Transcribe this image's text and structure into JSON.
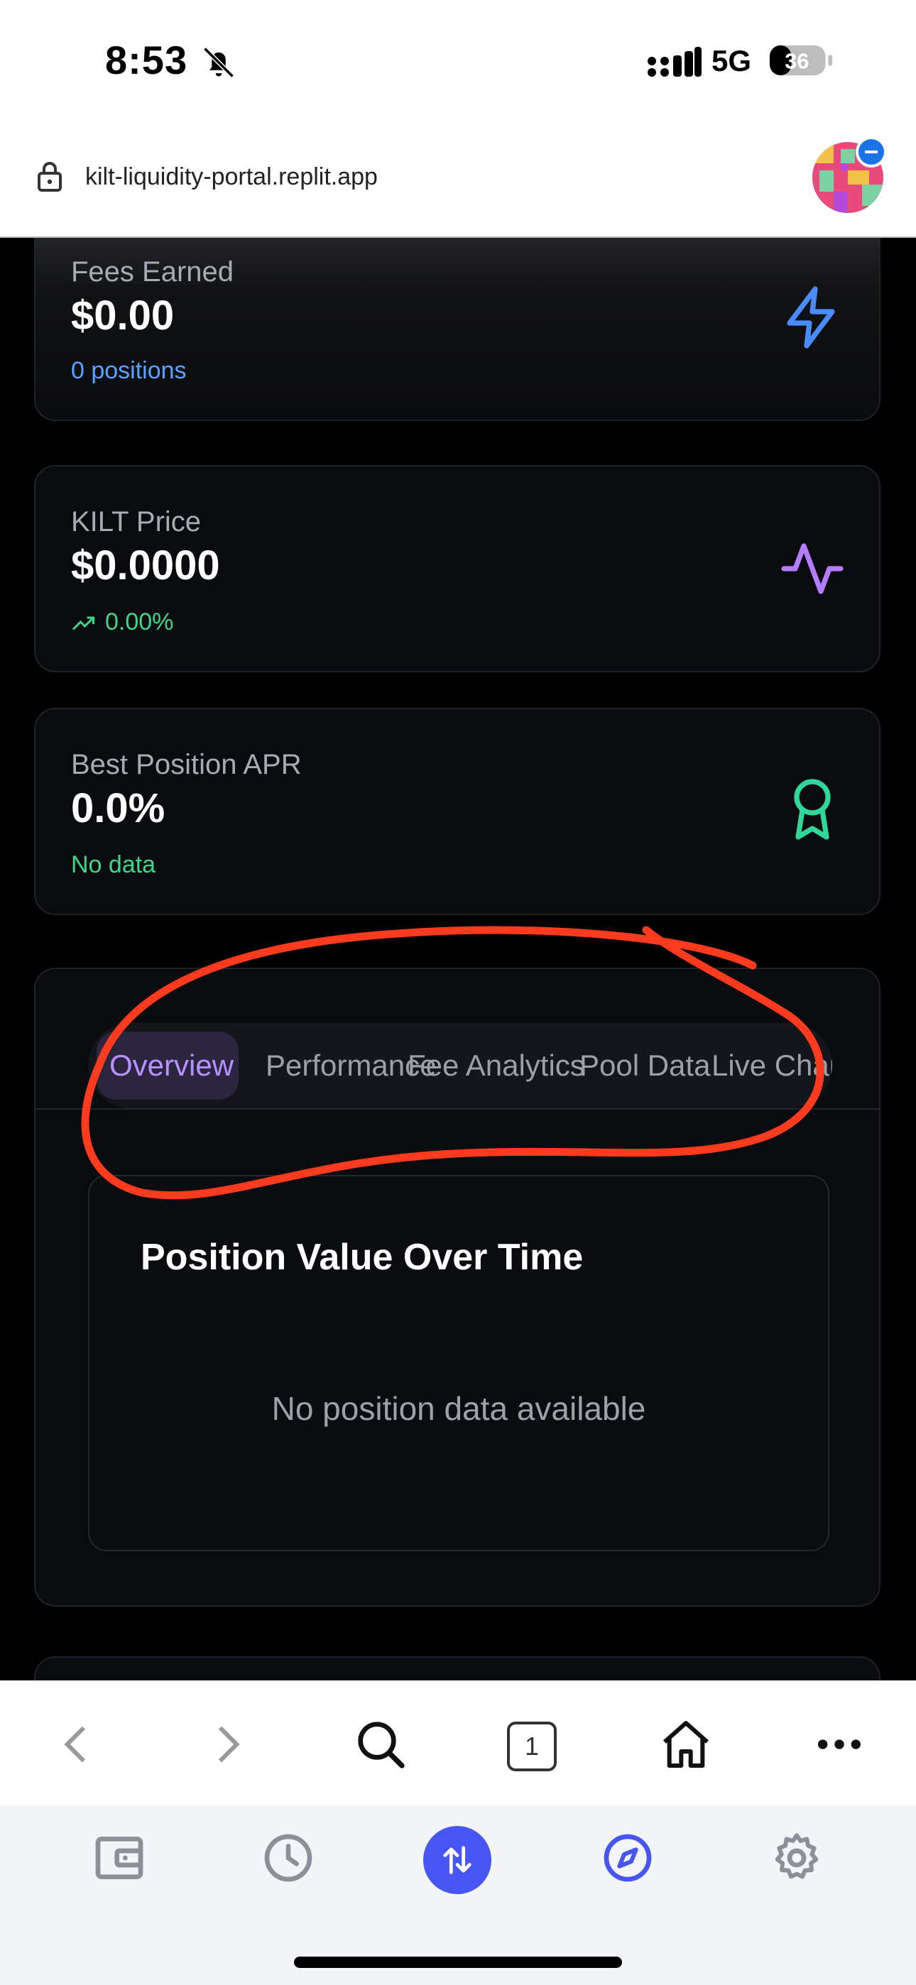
{
  "status": {
    "time": "8:53",
    "network": "5G",
    "battery": "36"
  },
  "browser": {
    "url": "kilt-liquidity-portal.replit.app",
    "tab_count": "1"
  },
  "stats": [
    {
      "label": "Fees Earned",
      "value": "$0.00",
      "sub": "0 positions",
      "sub_color": "#5aa2ff",
      "icon": "zap-icon",
      "icon_color": "#4a8cff"
    },
    {
      "label": "KILT Price",
      "value": "$0.0000",
      "sub": "0.00%",
      "sub_color": "#3ed68a",
      "icon": "activity-icon",
      "icon_color": "#b47cff"
    },
    {
      "label": "Best Position APR",
      "value": "0.0%",
      "sub": "No data",
      "sub_color": "#3ed68a",
      "icon": "award-icon",
      "icon_color": "#2fd89a"
    }
  ],
  "tabs": [
    {
      "label": "Overview",
      "active": true
    },
    {
      "label": "Performance",
      "active": false
    },
    {
      "label": "Fee Analytics",
      "active": false
    },
    {
      "label": "Pool Data",
      "active": false
    },
    {
      "label": "Live Charts",
      "active": false
    }
  ],
  "chart_panel": {
    "title": "Position Value Over Time",
    "empty_message": "No position data available"
  },
  "colors": {
    "accent": "#b592ff",
    "annotation": "#ff3b1f",
    "wallet_center": "#4755f2"
  }
}
